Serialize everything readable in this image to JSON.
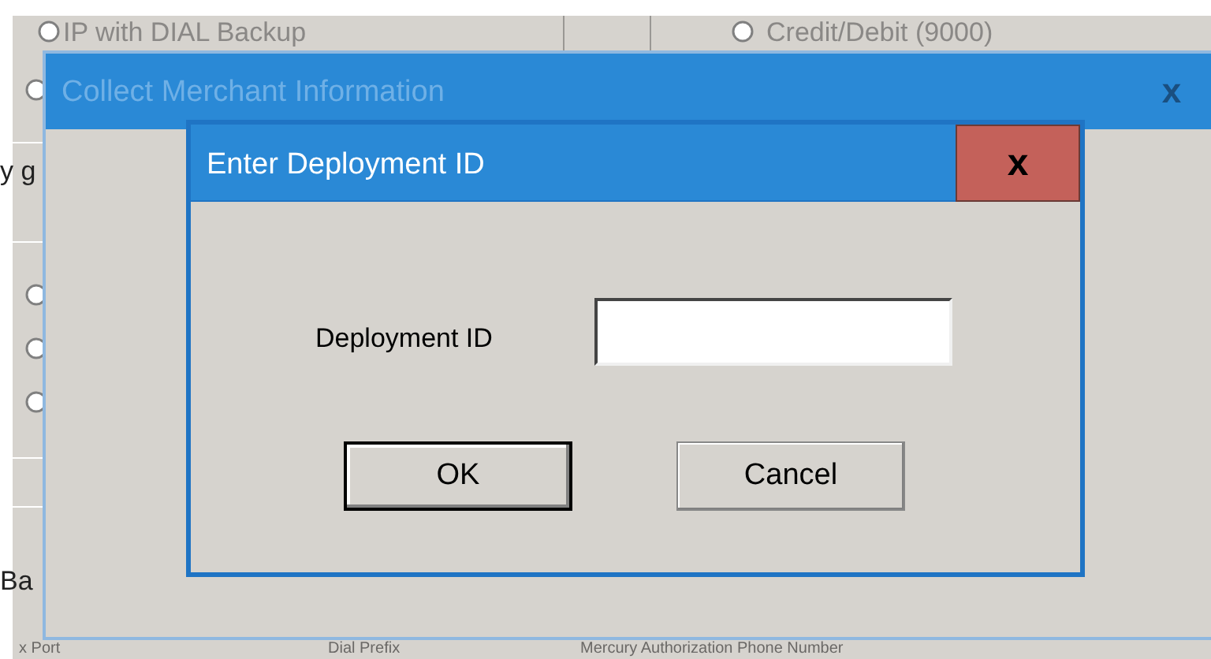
{
  "background_form": {
    "radios": [
      {
        "label": "IP with DIAL Backup",
        "selected": false
      },
      {
        "label": "Credit/Debit (9000)",
        "selected": false
      }
    ],
    "partial_radios": [
      {
        "selected": false
      },
      {
        "selected": false
      },
      {
        "selected": false
      },
      {
        "selected": false
      }
    ],
    "partial_texts": [
      "y g",
      "Ba"
    ],
    "bottom_labels": [
      "x Port",
      "Dial Prefix",
      "Mercury Authorization Phone Number"
    ]
  },
  "outer_window": {
    "title": "Collect Merchant Information",
    "close": "x"
  },
  "dialog": {
    "title": "Enter Deployment ID",
    "close": "x",
    "field": {
      "label": "Deployment ID"
    },
    "buttons": [
      {
        "label": "OK",
        "default": true
      },
      {
        "label": "Cancel",
        "default": false
      }
    ]
  }
}
